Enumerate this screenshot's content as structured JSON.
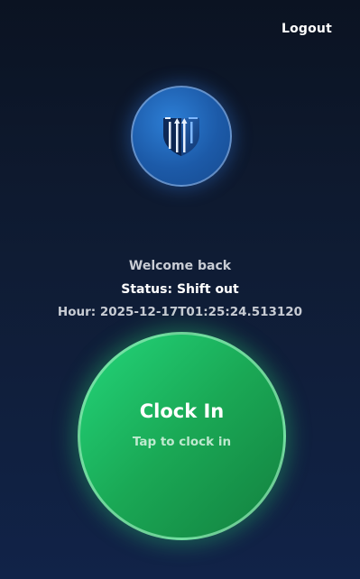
{
  "header": {
    "logout_label": "Logout"
  },
  "logo": {
    "icon": "shield-columns-icon"
  },
  "info": {
    "welcome": "Welcome back",
    "status": "Status: Shift out",
    "hour": "Hour: 2025-12-17T01:25:24.513120"
  },
  "clock_button": {
    "title": "Clock In",
    "subtitle": "Tap to clock in"
  },
  "colors": {
    "background_top": "#0b1322",
    "background_bottom": "#112348",
    "logo_blue": "#1c5aa8",
    "button_green": "#1aa855"
  }
}
